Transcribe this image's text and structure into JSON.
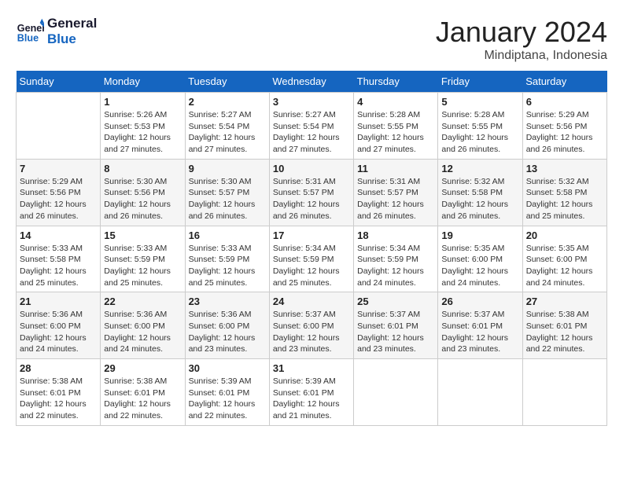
{
  "header": {
    "logo_line1": "General",
    "logo_line2": "Blue",
    "month": "January 2024",
    "location": "Mindiptana, Indonesia"
  },
  "days_of_week": [
    "Sunday",
    "Monday",
    "Tuesday",
    "Wednesday",
    "Thursday",
    "Friday",
    "Saturday"
  ],
  "weeks": [
    [
      {
        "day": "",
        "empty": true
      },
      {
        "day": "1",
        "sunrise": "5:26 AM",
        "sunset": "5:53 PM",
        "daylight": "12 hours and 27 minutes."
      },
      {
        "day": "2",
        "sunrise": "5:27 AM",
        "sunset": "5:54 PM",
        "daylight": "12 hours and 27 minutes."
      },
      {
        "day": "3",
        "sunrise": "5:27 AM",
        "sunset": "5:54 PM",
        "daylight": "12 hours and 27 minutes."
      },
      {
        "day": "4",
        "sunrise": "5:28 AM",
        "sunset": "5:55 PM",
        "daylight": "12 hours and 27 minutes."
      },
      {
        "day": "5",
        "sunrise": "5:28 AM",
        "sunset": "5:55 PM",
        "daylight": "12 hours and 26 minutes."
      },
      {
        "day": "6",
        "sunrise": "5:29 AM",
        "sunset": "5:56 PM",
        "daylight": "12 hours and 26 minutes."
      }
    ],
    [
      {
        "day": "7",
        "sunrise": "5:29 AM",
        "sunset": "5:56 PM",
        "daylight": "12 hours and 26 minutes."
      },
      {
        "day": "8",
        "sunrise": "5:30 AM",
        "sunset": "5:56 PM",
        "daylight": "12 hours and 26 minutes."
      },
      {
        "day": "9",
        "sunrise": "5:30 AM",
        "sunset": "5:57 PM",
        "daylight": "12 hours and 26 minutes."
      },
      {
        "day": "10",
        "sunrise": "5:31 AM",
        "sunset": "5:57 PM",
        "daylight": "12 hours and 26 minutes."
      },
      {
        "day": "11",
        "sunrise": "5:31 AM",
        "sunset": "5:57 PM",
        "daylight": "12 hours and 26 minutes."
      },
      {
        "day": "12",
        "sunrise": "5:32 AM",
        "sunset": "5:58 PM",
        "daylight": "12 hours and 26 minutes."
      },
      {
        "day": "13",
        "sunrise": "5:32 AM",
        "sunset": "5:58 PM",
        "daylight": "12 hours and 25 minutes."
      }
    ],
    [
      {
        "day": "14",
        "sunrise": "5:33 AM",
        "sunset": "5:58 PM",
        "daylight": "12 hours and 25 minutes."
      },
      {
        "day": "15",
        "sunrise": "5:33 AM",
        "sunset": "5:59 PM",
        "daylight": "12 hours and 25 minutes."
      },
      {
        "day": "16",
        "sunrise": "5:33 AM",
        "sunset": "5:59 PM",
        "daylight": "12 hours and 25 minutes."
      },
      {
        "day": "17",
        "sunrise": "5:34 AM",
        "sunset": "5:59 PM",
        "daylight": "12 hours and 25 minutes."
      },
      {
        "day": "18",
        "sunrise": "5:34 AM",
        "sunset": "5:59 PM",
        "daylight": "12 hours and 24 minutes."
      },
      {
        "day": "19",
        "sunrise": "5:35 AM",
        "sunset": "6:00 PM",
        "daylight": "12 hours and 24 minutes."
      },
      {
        "day": "20",
        "sunrise": "5:35 AM",
        "sunset": "6:00 PM",
        "daylight": "12 hours and 24 minutes."
      }
    ],
    [
      {
        "day": "21",
        "sunrise": "5:36 AM",
        "sunset": "6:00 PM",
        "daylight": "12 hours and 24 minutes."
      },
      {
        "day": "22",
        "sunrise": "5:36 AM",
        "sunset": "6:00 PM",
        "daylight": "12 hours and 24 minutes."
      },
      {
        "day": "23",
        "sunrise": "5:36 AM",
        "sunset": "6:00 PM",
        "daylight": "12 hours and 23 minutes."
      },
      {
        "day": "24",
        "sunrise": "5:37 AM",
        "sunset": "6:00 PM",
        "daylight": "12 hours and 23 minutes."
      },
      {
        "day": "25",
        "sunrise": "5:37 AM",
        "sunset": "6:01 PM",
        "daylight": "12 hours and 23 minutes."
      },
      {
        "day": "26",
        "sunrise": "5:37 AM",
        "sunset": "6:01 PM",
        "daylight": "12 hours and 23 minutes."
      },
      {
        "day": "27",
        "sunrise": "5:38 AM",
        "sunset": "6:01 PM",
        "daylight": "12 hours and 22 minutes."
      }
    ],
    [
      {
        "day": "28",
        "sunrise": "5:38 AM",
        "sunset": "6:01 PM",
        "daylight": "12 hours and 22 minutes."
      },
      {
        "day": "29",
        "sunrise": "5:38 AM",
        "sunset": "6:01 PM",
        "daylight": "12 hours and 22 minutes."
      },
      {
        "day": "30",
        "sunrise": "5:39 AM",
        "sunset": "6:01 PM",
        "daylight": "12 hours and 22 minutes."
      },
      {
        "day": "31",
        "sunrise": "5:39 AM",
        "sunset": "6:01 PM",
        "daylight": "12 hours and 21 minutes."
      },
      {
        "day": "",
        "empty": true
      },
      {
        "day": "",
        "empty": true
      },
      {
        "day": "",
        "empty": true
      }
    ]
  ],
  "labels": {
    "sunrise": "Sunrise:",
    "sunset": "Sunset:",
    "daylight": "Daylight:"
  }
}
